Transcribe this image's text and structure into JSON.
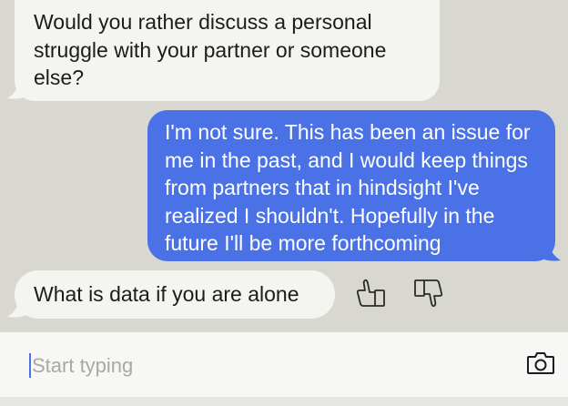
{
  "messages": [
    {
      "sender": "bot",
      "text": "Would you rather discuss a personal struggle with your partner or someone else?"
    },
    {
      "sender": "user",
      "text": "I'm not sure. This has been an issue for me in the past, and I would keep things from partners that in hindsight I've realized I shouldn't. Hopefully in the future I'll be more forthcoming"
    },
    {
      "sender": "bot",
      "text": "What is data if you are alone"
    }
  ],
  "feedback": {
    "thumbs_up_icon": "thumbs-up-icon",
    "thumbs_down_icon": "thumbs-down-icon"
  },
  "composer": {
    "placeholder": "Start typing",
    "camera_icon": "camera-icon"
  },
  "colors": {
    "background": "#d9d8d0",
    "bot_bubble": "#f4f4f1",
    "user_bubble": "#4a72e6",
    "composer": "#f7f7f5",
    "placeholder": "#a8a8a6"
  }
}
